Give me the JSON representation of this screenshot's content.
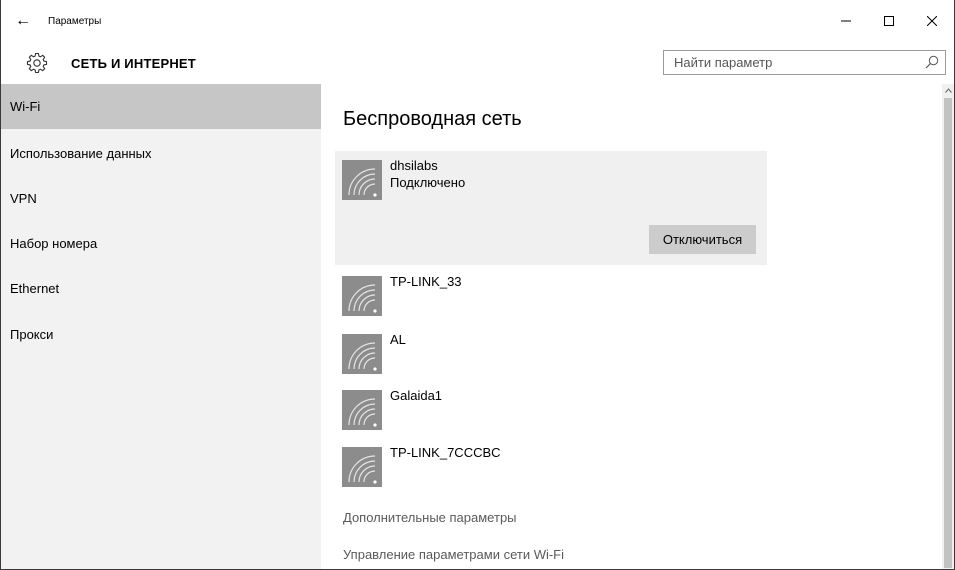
{
  "titlebar": {
    "back_icon": "back-arrow-icon",
    "title": "Параметры",
    "minimize_icon": "minimize-icon",
    "maximize_icon": "maximize-icon",
    "close_icon": "close-icon"
  },
  "header": {
    "icon": "gear-icon",
    "title": "СЕТЬ И ИНТЕРНЕТ",
    "search": {
      "value": "",
      "placeholder": "Найти параметр",
      "icon": "search-icon"
    }
  },
  "sidebar": {
    "items": [
      {
        "label": "Wi-Fi",
        "active": true
      },
      {
        "label": "Использование данных",
        "active": false
      },
      {
        "label": "VPN",
        "active": false
      },
      {
        "label": "Набор номера",
        "active": false
      },
      {
        "label": "Ethernet",
        "active": false
      },
      {
        "label": "Прокси",
        "active": false
      }
    ]
  },
  "main": {
    "title": "Беспроводная сеть",
    "connected": {
      "name": "dhsilabs",
      "status": "Подключено",
      "button": "Отключиться",
      "icon": "wifi-icon"
    },
    "networks": [
      {
        "name": "TP-LINK_33",
        "icon": "wifi-icon"
      },
      {
        "name": "AL",
        "icon": "wifi-icon"
      },
      {
        "name": "Galaida1",
        "icon": "wifi-icon"
      },
      {
        "name": "TP-LINK_7CCCBC",
        "icon": "wifi-icon"
      }
    ],
    "links": [
      "Дополнительные параметры",
      "Управление параметрами сети Wi-Fi"
    ]
  },
  "colors": {
    "sidebar_bg": "#f2f2f2",
    "active_item": "#c6c6c6",
    "wifi_tile": "#8c8c8c",
    "connected_bg": "#f0f0f0",
    "button_bg": "#cccccc",
    "link_text": "#5a5a5a"
  }
}
